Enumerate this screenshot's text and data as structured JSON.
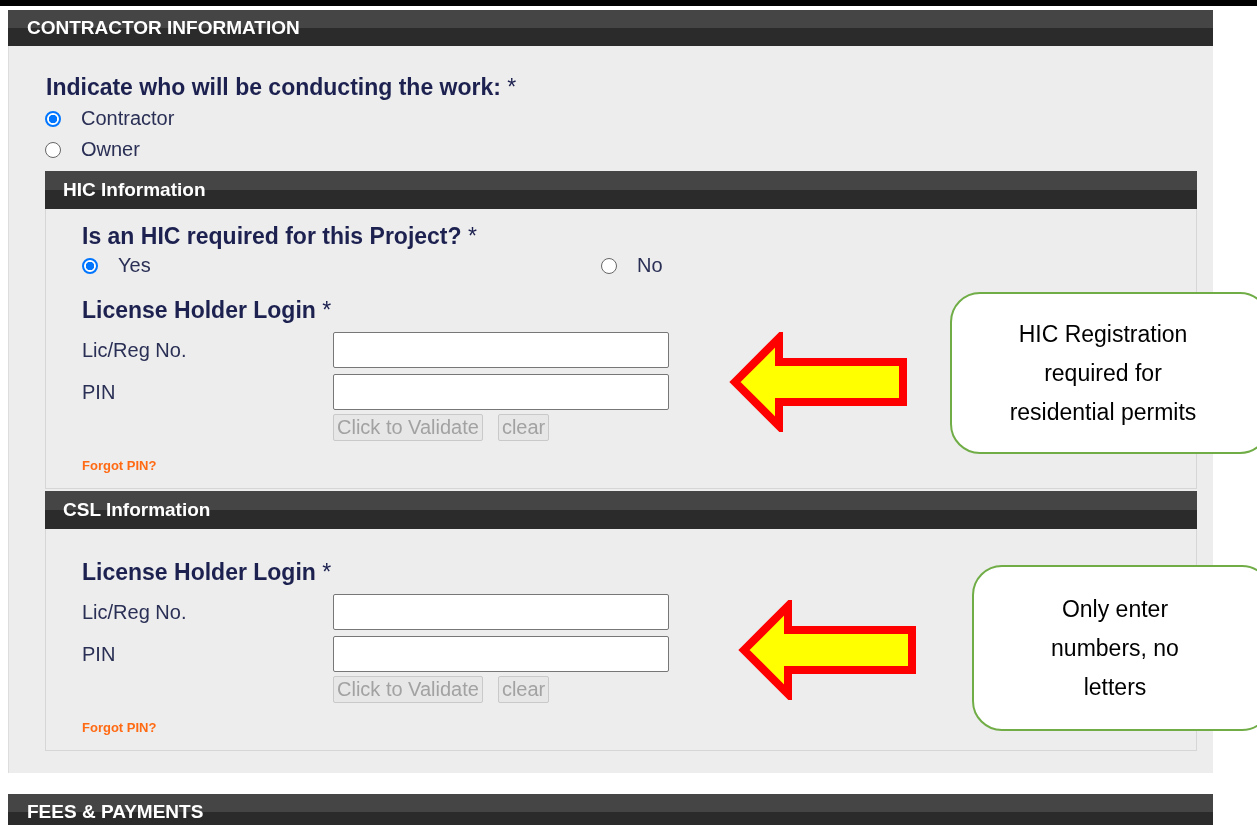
{
  "section": {
    "title": "CONTRACTOR INFORMATION"
  },
  "question": {
    "text": "**Indicate who will be conducting the work:** *"
  },
  "options": [
    {
      "label": "Contractor",
      "selected": true
    },
    {
      "label": "Owner",
      "selected": false
    }
  ],
  "subsections": [
    {
      "title": "HIC Information",
      "question": {
        "text": "**Is an HIC required for this Project?** *"
      },
      "question_options": [
        {
          "label": "Yes",
          "selected": true
        },
        {
          "label": "No",
          "selected": false
        }
      ],
      "login": {
        "heading": "**License Holder Login** *",
        "fields": [
          {
            "label": "Lic/Reg No."
          },
          {
            "label": "PIN"
          }
        ],
        "buttons": [
          {
            "label": "Click to Validate",
            "disabled": true
          },
          {
            "label": "clear",
            "disabled": true
          }
        ],
        "link": "Forgot PIN?"
      }
    },
    {
      "title": "CSL Information",
      "login": {
        "heading": "**License Holder Login** *",
        "fields": [
          {
            "label": "Lic/Reg No."
          },
          {
            "label": "PIN"
          }
        ],
        "buttons": [
          {
            "label": "Click to Validate",
            "disabled": true
          },
          {
            "label": "clear",
            "disabled": true
          }
        ],
        "link": "Forgot PIN?"
      }
    }
  ],
  "callouts": [
    {
      "lines": [
        "HIC Registration",
        "required for",
        "residential permits"
      ]
    },
    {
      "lines": [
        "Only enter",
        "numbers, no",
        "letters"
      ]
    }
  ],
  "next_section": {
    "title": "FEES & PAYMENTS"
  }
}
